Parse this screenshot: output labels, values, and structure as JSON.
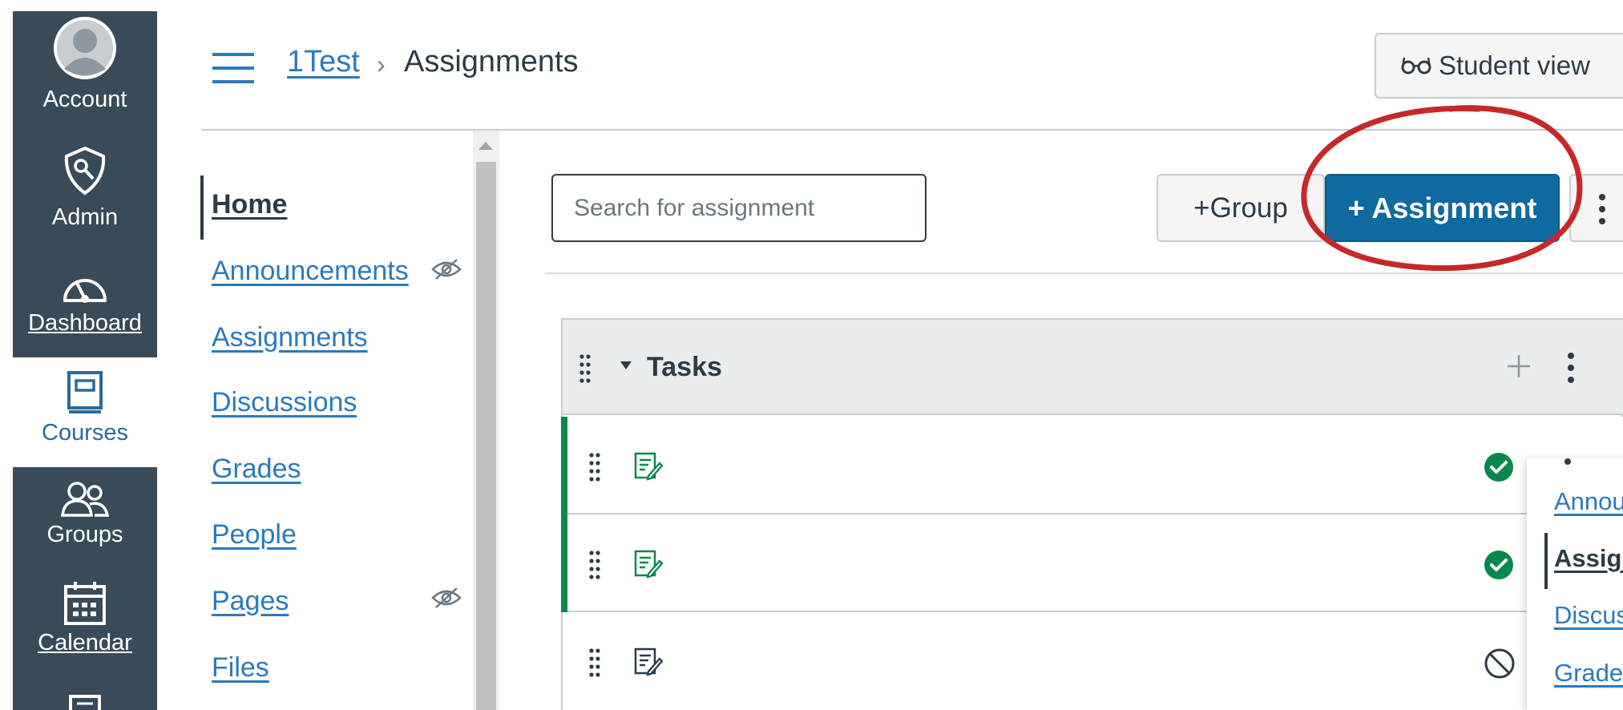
{
  "global_nav": {
    "account": "Account",
    "admin": "Admin",
    "dashboard": "Dashboard",
    "courses": "Courses",
    "groups": "Groups",
    "calendar": "Calendar"
  },
  "header": {
    "course_link": "1Test",
    "separator": "›",
    "current_page": "Assignments",
    "student_view": "Student view"
  },
  "course_nav": {
    "items": [
      {
        "label": "Home",
        "active": true
      },
      {
        "label": "Announcements",
        "hidden": true
      },
      {
        "label": "Assignments"
      },
      {
        "label": "Discussions"
      },
      {
        "label": "Grades"
      },
      {
        "label": "People"
      },
      {
        "label": "Pages",
        "hidden": true
      },
      {
        "label": "Files"
      }
    ]
  },
  "toolbar": {
    "search_placeholder": "Search for assignment",
    "group_label": "+Group",
    "assignment_label": "+ Assignment"
  },
  "assignment_group": {
    "title": "Tasks",
    "rows": [
      {
        "status": "published"
      },
      {
        "status": "published"
      },
      {
        "status": "unpublished"
      }
    ]
  },
  "popover_menu": {
    "items": [
      {
        "label": "Annou"
      },
      {
        "label": "Assign",
        "active": true
      },
      {
        "label": "Discus"
      },
      {
        "label": "Grades"
      }
    ]
  },
  "colors": {
    "nav_dark": "#394b58",
    "link": "#2b7abc",
    "primary_button": "#0e6a9f",
    "published_green": "#0b874b",
    "annotation_red": "#c62828"
  }
}
